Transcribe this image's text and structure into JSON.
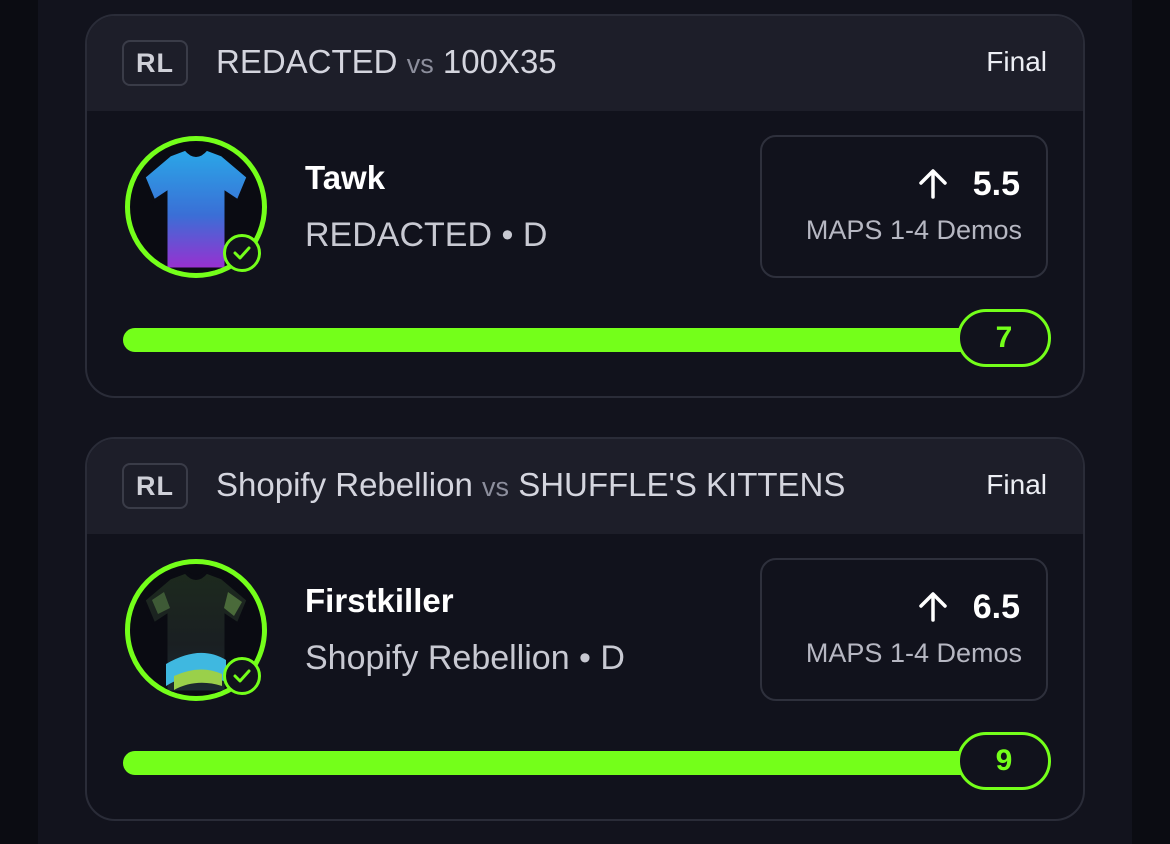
{
  "colors": {
    "accent": "#74ff1a",
    "card_bg": "#11121c",
    "header_bg": "#1d1e29",
    "page_bg": "#0b0c12"
  },
  "cards": [
    {
      "league": "RL",
      "home_team": "REDACTED",
      "vs": "vs",
      "away_team": "100X35",
      "status": "Final",
      "player": {
        "name": "Tawk",
        "team_position": "REDACTED • D",
        "avatar_icon": "jersey-icon",
        "verified_icon": "check-circle-icon"
      },
      "line": {
        "direction_icon": "arrow-up-icon",
        "value": "5.5",
        "market": "MAPS 1-4 Demos"
      },
      "result": {
        "value": "7",
        "progress_percent": 100
      }
    },
    {
      "league": "RL",
      "home_team": "Shopify Rebellion",
      "vs": "vs",
      "away_team": "SHUFFLE'S KITTENS",
      "status": "Final",
      "player": {
        "name": "Firstkiller",
        "team_position": "Shopify Rebellion • D",
        "avatar_icon": "jersey-icon",
        "verified_icon": "check-circle-icon"
      },
      "line": {
        "direction_icon": "arrow-up-icon",
        "value": "6.5",
        "market": "MAPS 1-4 Demos"
      },
      "result": {
        "value": "9",
        "progress_percent": 100
      }
    }
  ]
}
